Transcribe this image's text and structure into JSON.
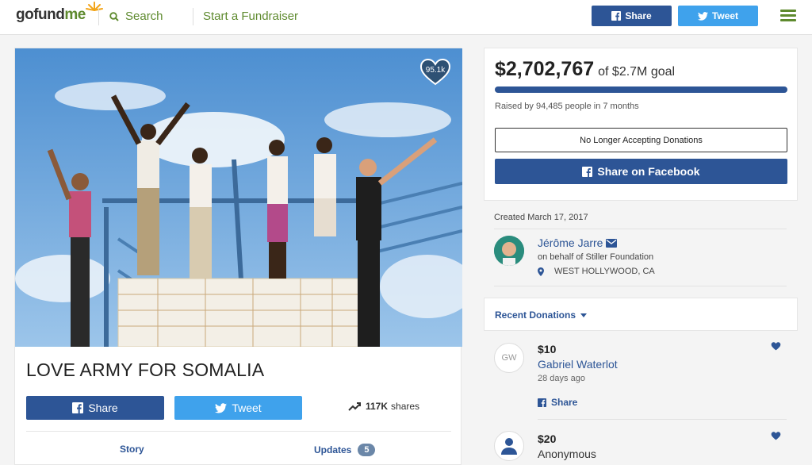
{
  "header": {
    "logo_text_a": "gofund",
    "logo_text_b": "me",
    "search_label": "Search",
    "start_label": "Start a Fundraiser",
    "share_label": "Share",
    "tweet_label": "Tweet"
  },
  "campaign": {
    "title": "LOVE ARMY FOR SOMALIA",
    "hearts": "95.1k",
    "share_label": "Share",
    "tweet_label": "Tweet",
    "shares_count": "117K",
    "shares_suffix": "shares",
    "tabs": [
      {
        "label": "Story"
      },
      {
        "label": "Updates",
        "badge": "5"
      }
    ]
  },
  "funding": {
    "raised": "$2,702,767",
    "goal": "of $2.7M goal",
    "progress_fraction": 1.0,
    "raised_by": "Raised by 94,485 people in 7 months",
    "status_button": "No Longer Accepting Donations",
    "fb_share_label": "Share on Facebook"
  },
  "organizer": {
    "created": "Created March 17, 2017",
    "name": "Jérôme Jarre",
    "behalf": "on behalf of Stiller Foundation",
    "location": "WEST HOLLYWOOD, CA"
  },
  "donations": {
    "label": "Recent Donations",
    "items": [
      {
        "initials": "GW",
        "amount": "$10",
        "name": "Gabriel Waterlot",
        "ago": "28 days ago",
        "share": "Share"
      },
      {
        "initials": "",
        "amount": "$20",
        "name": "Anonymous"
      }
    ]
  },
  "colors": {
    "brand_green": "#5e8a2e",
    "facebook_blue": "#2d5596",
    "twitter_blue": "#3fa2ec"
  }
}
